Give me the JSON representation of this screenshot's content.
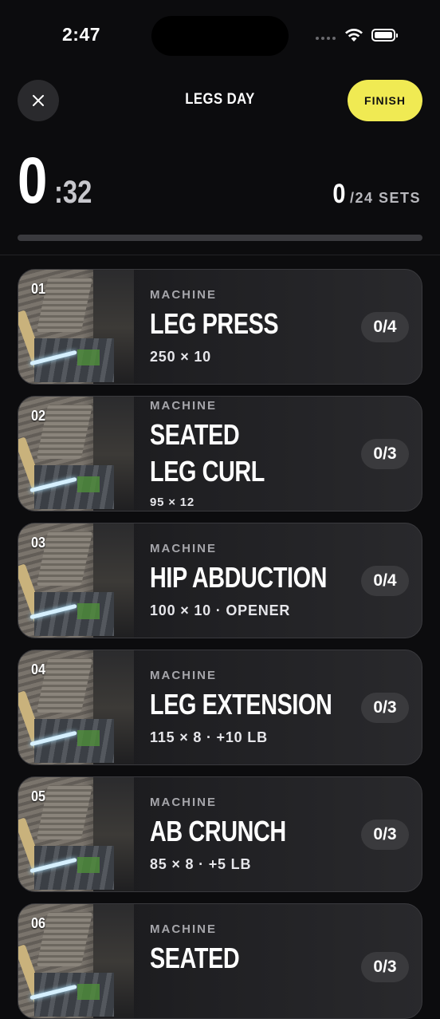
{
  "status": {
    "time": "2:47"
  },
  "header": {
    "title": "LEGS DAY",
    "finish_label": "FINISH"
  },
  "timer": {
    "minutes": "0",
    "seconds": ":32"
  },
  "sets": {
    "done": "0",
    "total": "/24 SETS",
    "progress": 0
  },
  "colors": {
    "accent": "#f0ea53",
    "background": "#0c0c0e",
    "card": "#1f1f22"
  },
  "exercises": [
    {
      "index": "01",
      "category": "MACHINE",
      "name_lines": [
        "LEG PRESS"
      ],
      "detail": "250 × 10",
      "count": "0/4"
    },
    {
      "index": "02",
      "category": "MACHINE",
      "name_lines": [
        "SEATED",
        "LEG CURL"
      ],
      "detail": "95 × 12",
      "count": "0/3"
    },
    {
      "index": "03",
      "category": "MACHINE",
      "name_lines": [
        "HIP ABDUCTION"
      ],
      "detail": "100 × 10 · OPENER",
      "count": "0/4"
    },
    {
      "index": "04",
      "category": "MACHINE",
      "name_lines": [
        "LEG EXTENSION"
      ],
      "detail": "115 × 8 · +10 LB",
      "count": "0/3"
    },
    {
      "index": "05",
      "category": "MACHINE",
      "name_lines": [
        "AB CRUNCH"
      ],
      "detail": "85 × 8 · +5 LB",
      "count": "0/3"
    },
    {
      "index": "06",
      "category": "MACHINE",
      "name_lines": [
        "SEATED"
      ],
      "detail": "",
      "count": "0/3"
    }
  ]
}
